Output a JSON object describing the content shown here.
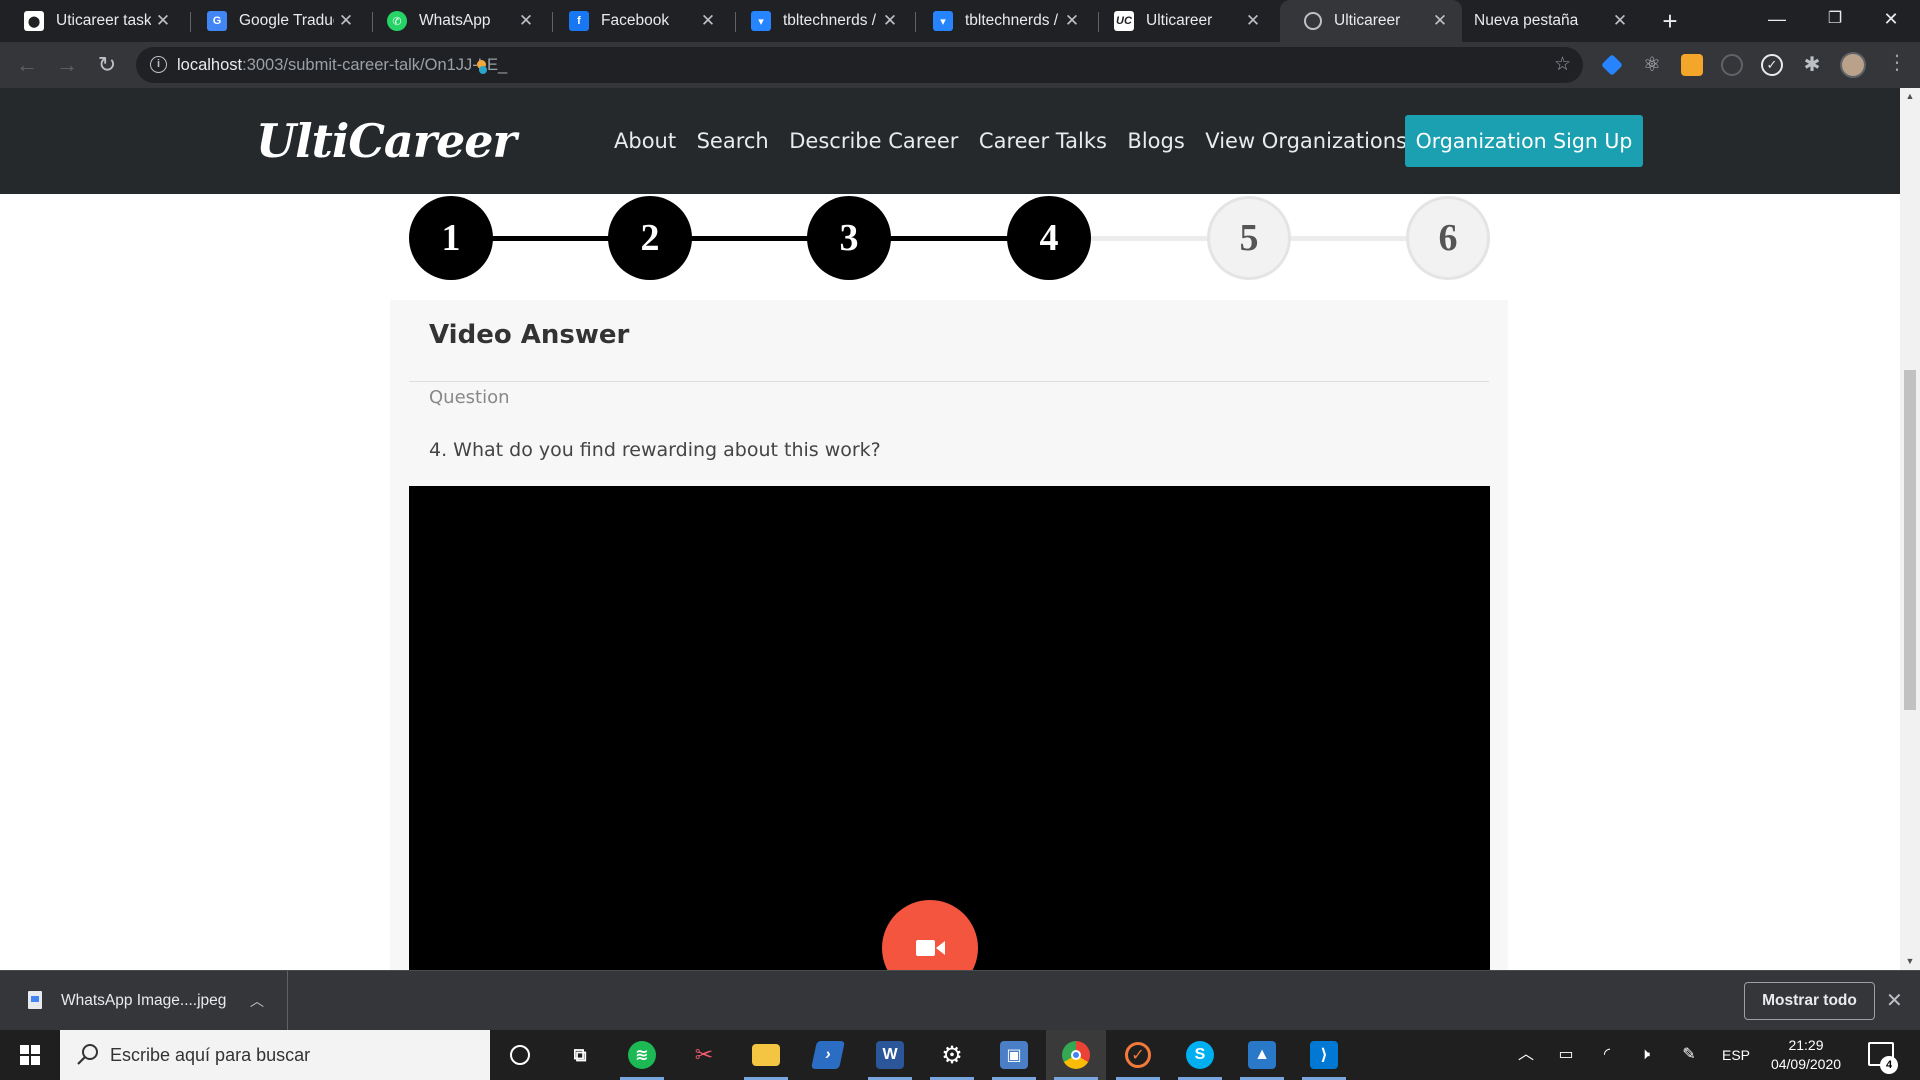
{
  "browser": {
    "tabs": [
      {
        "title": "Uticareer tasks",
        "icon": "github-icon",
        "icon_color": "#ffffff"
      },
      {
        "title": "Google Traduct",
        "icon": "google-translate-icon",
        "icon_color": "#4285f4"
      },
      {
        "title": "WhatsApp",
        "icon": "whatsapp-icon",
        "icon_color": "#25d366"
      },
      {
        "title": "Facebook",
        "icon": "facebook-icon",
        "icon_color": "#1877f2"
      },
      {
        "title": "tbltechnerds / u",
        "icon": "bitbucket-icon",
        "icon_color": "#2684ff"
      },
      {
        "title": "tbltechnerds / u",
        "icon": "bitbucket-icon",
        "icon_color": "#2684ff"
      },
      {
        "title": "Ulticareer",
        "icon": "ulticareer-icon",
        "icon_color": "#ffffff",
        "icon_text": "UC"
      },
      {
        "title": "Ulticareer",
        "icon": "globe-icon",
        "icon_color": "#bdc1c6",
        "active": true
      },
      {
        "title": "Nueva pestaña",
        "icon": "none"
      }
    ],
    "url_host": "localhost",
    "url_path": ":3003/submit-career-talk/On1JJ-LE_",
    "url_cursor": "_"
  },
  "site": {
    "logo": "UltiCareer",
    "nav": [
      "About",
      "Search",
      "Describe Career",
      "Career Talks",
      "Blogs",
      "View Organizations"
    ],
    "cta": "Organization Sign Up",
    "colors": {
      "header_bg": "#25292c",
      "cta_bg": "#1ba0b1",
      "record_btn": "#f4553f"
    }
  },
  "stepper": {
    "steps": [
      "1",
      "2",
      "3",
      "4",
      "5",
      "6"
    ],
    "current": 4
  },
  "card": {
    "title": "Video Answer",
    "question_label": "Question",
    "question_text": "4. What do you find rewarding about this work?",
    "record_icon": "video-camera-icon"
  },
  "downloads": {
    "file": "WhatsApp Image....jpeg",
    "show_all": "Mostrar todo"
  },
  "taskbar": {
    "search_placeholder": "Escribe aquí para buscar",
    "language": "ESP",
    "time": "21:29",
    "date": "04/09/2020",
    "notifications": "4"
  }
}
